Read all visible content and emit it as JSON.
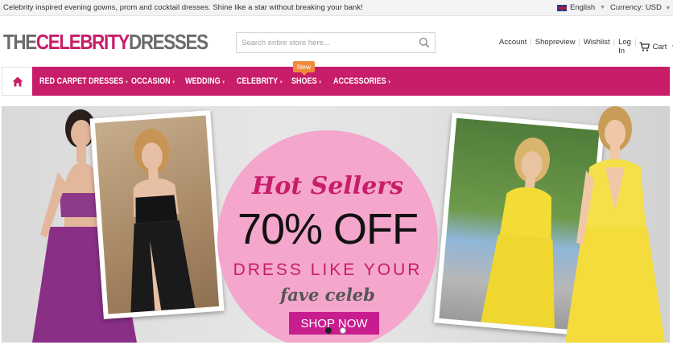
{
  "topbar": {
    "tagline": "Celebrity inspired evening gowns, prom and cocktail dresses. Shine like a star without breaking your bank!",
    "language": "English",
    "currency": "Currency: USD"
  },
  "header": {
    "logo_part1": "THE",
    "logo_part2": "CELEBRITY",
    "logo_part3": "DRESSES",
    "search_placeholder": "Search entire store here...",
    "links": {
      "account": "Account",
      "shopreview": "Shopreview",
      "wishlist": "Wishlist",
      "login": "Log In",
      "cart": "Cart"
    }
  },
  "nav": {
    "badge": "New",
    "items": [
      {
        "label": "RED CARPET DRESSES"
      },
      {
        "label": "OCCASION"
      },
      {
        "label": "WEDDING"
      },
      {
        "label": "CELEBRITY"
      },
      {
        "label": "SHOES"
      },
      {
        "label": "ACCESSORIES"
      }
    ]
  },
  "banner": {
    "headline": "Hot Sellers",
    "discount": "70% OFF",
    "line1": "DRESS LIKE YOUR",
    "line2": "fave celeb",
    "cta": "SHOP NOW"
  },
  "colors": {
    "brand_pink": "#c81d68",
    "badge_orange": "#f08a3b",
    "circle_pink": "#f4a6cc",
    "cta_magenta": "#c81d8e"
  }
}
